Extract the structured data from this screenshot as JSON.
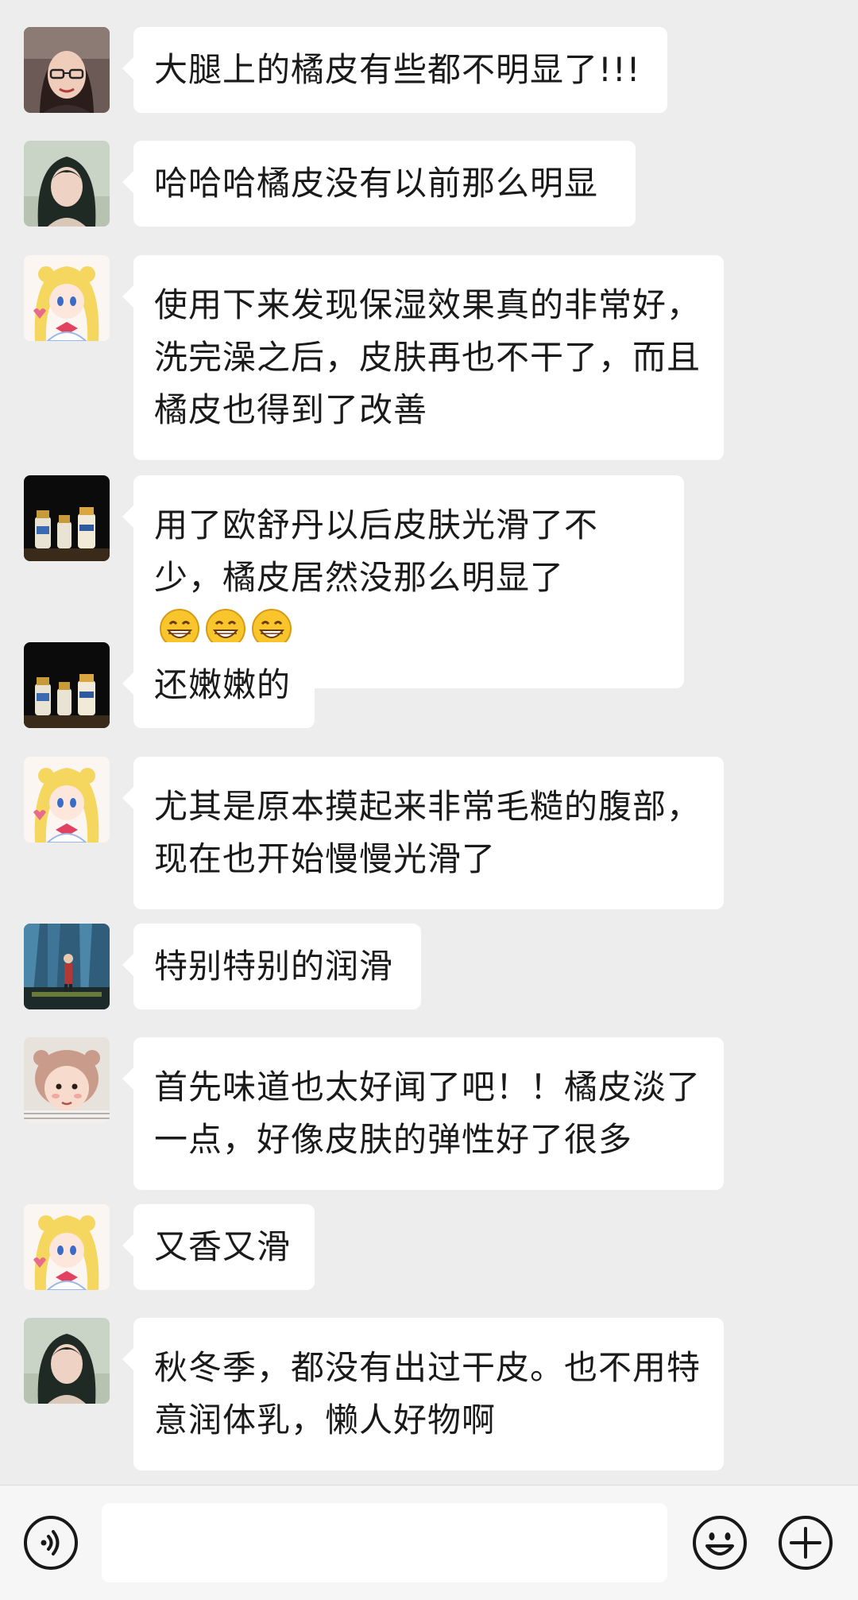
{
  "messages": [
    {
      "avatar": "avatar-woman-glasses",
      "text": "大腿上的橘皮有些都不明显了!!!"
    },
    {
      "avatar": "avatar-woman-dark-hair",
      "text": "哈哈哈橘皮没有以前那么明显"
    },
    {
      "avatar": "avatar-sailor-moon",
      "text": "使用下来发现保湿效果真的非常好，洗完澡之后，皮肤再也不干了，而且橘皮也得到了改善"
    },
    {
      "avatar": "avatar-bottles",
      "text": "用了欧舒丹以后皮肤光滑了不少，橘皮居然没那么明显了",
      "emoji": [
        "grin-emoji",
        "grin-emoji",
        "grin-emoji"
      ]
    },
    {
      "avatar": "avatar-bottles",
      "text": "还嫩嫩的"
    },
    {
      "avatar": "avatar-sailor-moon",
      "text": "尤其是原本摸起来非常毛糙的腹部，现在也开始慢慢光滑了"
    },
    {
      "avatar": "avatar-stage-person",
      "text": "特别特别的润滑"
    },
    {
      "avatar": "avatar-baby",
      "text": "首先味道也太好闻了吧！！橘皮淡了一点，好像皮肤的弹性好了很多"
    },
    {
      "avatar": "avatar-sailor-moon",
      "text": "又香又滑"
    },
    {
      "avatar": "avatar-woman-dark-hair",
      "text": "秋冬季，都没有出过干皮。也不用特意润体乳，懒人好物啊"
    }
  ],
  "input_bar": {
    "voice_icon": "voice-icon",
    "text_value": "",
    "emoji_icon": "smiley-icon",
    "plus_icon": "plus-icon"
  },
  "colors": {
    "background": "#ededed",
    "bubble": "#ffffff",
    "text": "#1a1a1a",
    "input_bar": "#f6f6f6"
  }
}
